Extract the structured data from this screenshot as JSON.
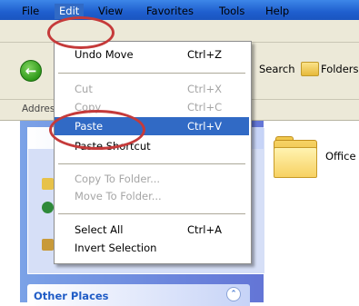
{
  "menubar": {
    "file": "File",
    "edit": "Edit",
    "view": "View",
    "favorites": "Favorites",
    "tools": "Tools",
    "help": "Help"
  },
  "toolbar": {
    "search": "Search",
    "folders": "Folders"
  },
  "addressbar": {
    "label": "Address"
  },
  "edit_menu": {
    "items": [
      {
        "label": "Undo Move",
        "shortcut": "Ctrl+Z",
        "enabled": true
      },
      {
        "label": "Cut",
        "shortcut": "Ctrl+X",
        "enabled": false
      },
      {
        "label": "Copy",
        "shortcut": "Ctrl+C",
        "enabled": false
      },
      {
        "label": "Paste",
        "shortcut": "Ctrl+V",
        "enabled": true,
        "highlighted": true
      },
      {
        "label": "Paste Shortcut",
        "shortcut": "",
        "enabled": true
      },
      {
        "label": "Copy To Folder...",
        "shortcut": "",
        "enabled": false
      },
      {
        "label": "Move To Folder...",
        "shortcut": "",
        "enabled": false
      },
      {
        "label": "Select All",
        "shortcut": "Ctrl+A",
        "enabled": true
      },
      {
        "label": "Invert Selection",
        "shortcut": "",
        "enabled": true
      }
    ]
  },
  "task_pane": {
    "other_places": "Other Places"
  },
  "content": {
    "folder_label": "Office"
  },
  "colors": {
    "highlight": "#316ac5",
    "annotation": "#c53a3a",
    "menubar": "#ece9d8"
  }
}
